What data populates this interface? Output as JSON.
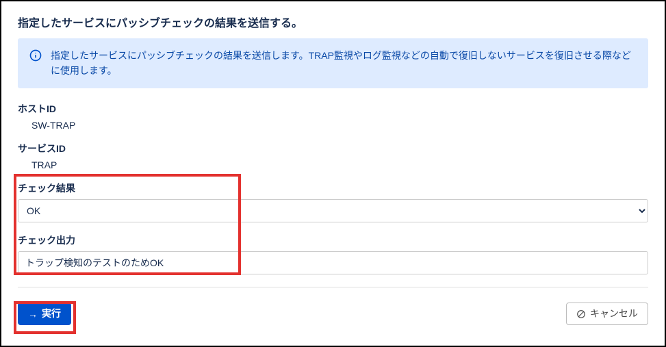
{
  "title": "指定したサービスにパッシブチェックの結果を送信する。",
  "info": {
    "text": "指定したサービスにパッシブチェックの結果を送信します。TRAP監視やログ監視などの自動で復旧しないサービスを復旧させる際などに使用します。"
  },
  "fields": {
    "host_id": {
      "label": "ホストID",
      "value": "SW-TRAP"
    },
    "service_id": {
      "label": "サービスID",
      "value": "TRAP"
    },
    "check_result": {
      "label": "チェック結果",
      "selected": "OK"
    },
    "check_output": {
      "label": "チェック出力",
      "value": "トラップ検知のテストのためOK"
    }
  },
  "actions": {
    "execute": "実行",
    "cancel": "キャンセル"
  }
}
